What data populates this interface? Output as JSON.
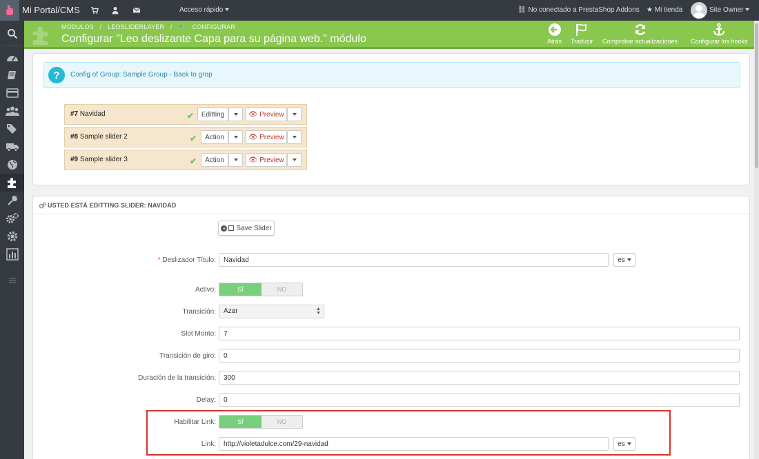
{
  "topbar": {
    "brand": "Mi Portal/CMS",
    "quick_access": "Acceso rápido",
    "addons_status": "No conectado a PrestaShop Addons",
    "my_store": "Mi tienda",
    "user": "Site Owner"
  },
  "header": {
    "breadcrumb": [
      "MÓDULOS",
      "/",
      "LEOSLIDERLAYER",
      "/",
      "CONFIGURAR"
    ],
    "title": "Configurar \"Leo deslizante Capa para su página web.\" módulo",
    "actions": [
      {
        "label": "Atrás",
        "icon": "arrow-left-circle-icon"
      },
      {
        "label": "Traducir",
        "icon": "flag-icon"
      },
      {
        "label": "Comprobar actualizaciones",
        "icon": "refresh-icon"
      },
      {
        "label": "Configurar los hooks",
        "icon": "anchor-icon"
      }
    ]
  },
  "sidebar": {
    "items": [
      "search-icon",
      "dashboard-icon",
      "book-icon",
      "credit-card-icon",
      "users-icon",
      "tags-icon",
      "truck-icon",
      "globe-icon",
      "puzzle-icon",
      "wrench-icon",
      "cogs-icon",
      "gear-icon",
      "stats-icon",
      "menu-icon"
    ]
  },
  "group_panel": {
    "info_text": "Config of Group: Sample Group - Back to grop",
    "sliders": [
      {
        "id": "#7",
        "name": "Navidad",
        "action": "Editting",
        "preview": "Preview"
      },
      {
        "id": "#8",
        "name": "Sample slider 2",
        "action": "Action",
        "preview": "Preview"
      },
      {
        "id": "#9",
        "name": "Sample slider 3",
        "action": "Action",
        "preview": "Preview"
      }
    ]
  },
  "form": {
    "heading": "USTED ESTÁ EDITTING SLIDER: NAVIDAD",
    "save_label": "Save Slider",
    "title_label": "Deslizador Título:",
    "title_value": "Navidad",
    "lang": "es",
    "active_label": "Activo:",
    "yes": "SÍ",
    "no": "NO",
    "transition_label": "Transición:",
    "transition_value": "Azar",
    "slot_label": "Slot Monto:",
    "slot_value": "7",
    "rotation_label": "Transición de giro:",
    "rotation_value": "0",
    "duration_label": "Duración de la transición:",
    "duration_value": "300",
    "delay_label": "Delay:",
    "delay_value": "0",
    "enable_link_label": "Habilitar Link:",
    "link_label": "Link:",
    "link_value": "http://violetadulce.com/29-navidad"
  },
  "colors": {
    "header_green": "#8ac74e",
    "topbar_dark": "#363a41",
    "switch_on": "#78d07d",
    "highlight_red": "#d7312b",
    "info_blue": "#25b9d7"
  }
}
